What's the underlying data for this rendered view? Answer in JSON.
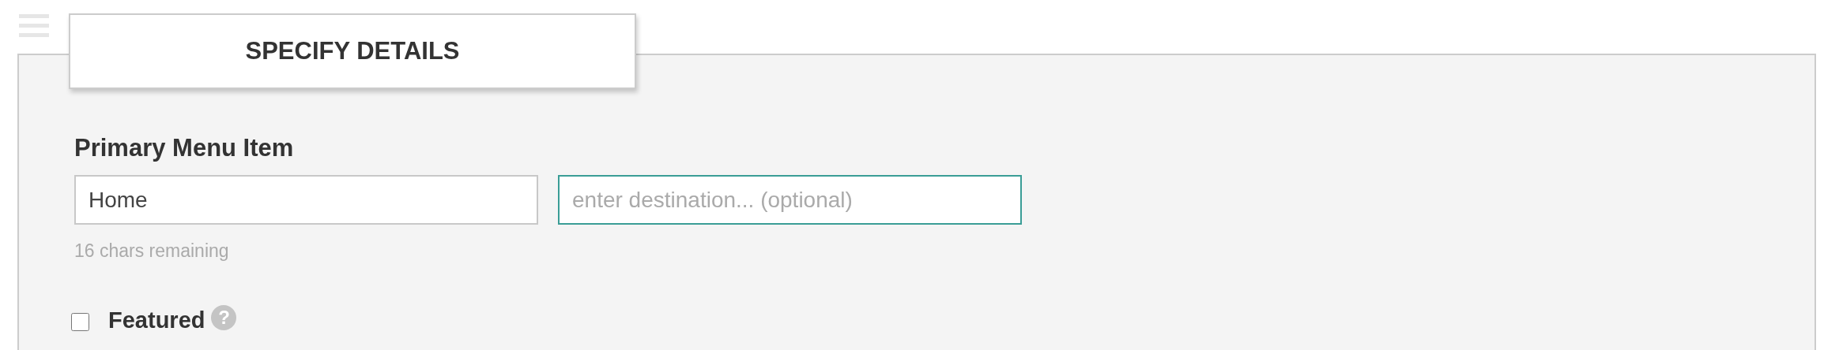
{
  "header": {
    "title": "SPECIFY DETAILS"
  },
  "form": {
    "label": "Primary Menu Item",
    "name_field": {
      "value": "Home"
    },
    "destination_field": {
      "placeholder": "enter destination... (optional)",
      "focused": true
    },
    "hint": "16 chars remaining",
    "featured": {
      "label": "Featured",
      "checked": false,
      "help": "?"
    }
  }
}
